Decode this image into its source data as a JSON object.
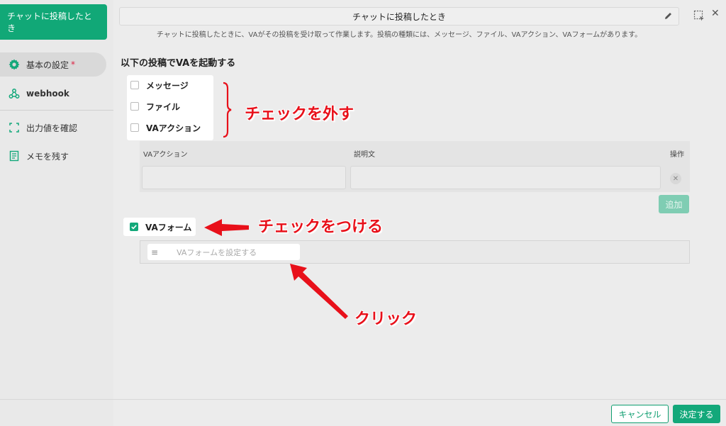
{
  "sidebar": {
    "title": "チャットに投稿したとき",
    "items": [
      {
        "label": "基本の設定",
        "required": "*",
        "icon": "gear-icon"
      },
      {
        "label": "webhook",
        "icon": "webhook-icon"
      },
      {
        "label": "出力値を確認",
        "icon": "bracket-frame-icon"
      },
      {
        "label": "メモを残す",
        "icon": "memo-icon"
      }
    ]
  },
  "header": {
    "title": "チャットに投稿したとき",
    "description": "チャットに投稿したときに、VAがその投稿を受け取って作業します。投稿の種類には、メッセージ、ファイル、VAアクション、VAフォームがあります。"
  },
  "section": {
    "title": "以下の投稿でVAを起動する",
    "checkboxes": [
      {
        "label": "メッセージ",
        "checked": false
      },
      {
        "label": "ファイル",
        "checked": false
      },
      {
        "label": "VAアクション",
        "checked": false
      }
    ]
  },
  "table": {
    "headers": [
      "VAアクション",
      "説明文",
      "操作"
    ],
    "add_label": "追加"
  },
  "vaform": {
    "label": "VAフォーム",
    "checked": true,
    "placeholder": "VAフォームを設定する"
  },
  "annotations": {
    "uncheck": "チェックを外す",
    "check": "チェックをつける",
    "click": "クリック",
    "color": "#e8101a"
  },
  "footer": {
    "cancel": "キャンセル",
    "ok": "決定する"
  },
  "colors": {
    "accent": "#13a87a"
  }
}
